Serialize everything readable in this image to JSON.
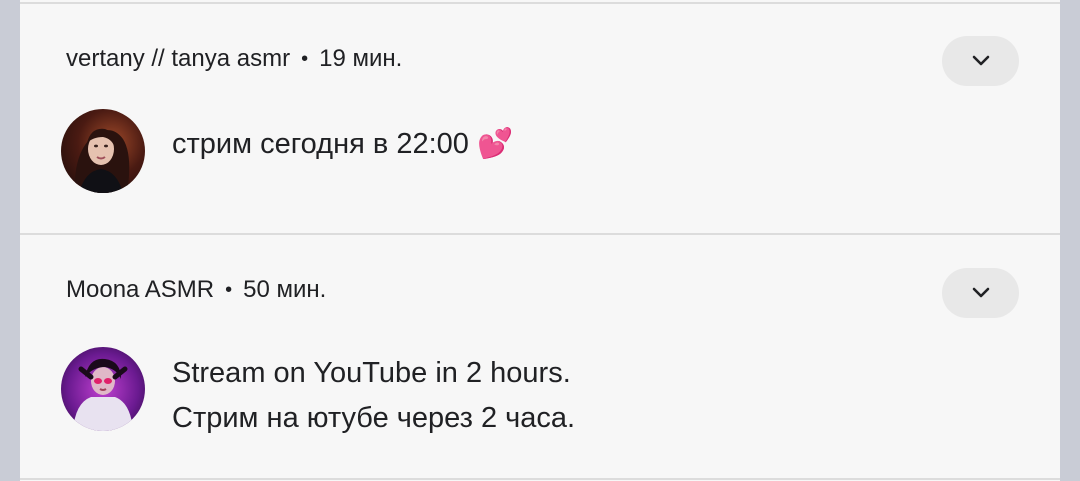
{
  "notifications": [
    {
      "app_name": "vertany // tanya asmr",
      "separator": "•",
      "time": "19 мин.",
      "message_lines": [
        "стрим сегодня в 22:00 💕"
      ],
      "expand_icon": "chevron-down-icon",
      "avatar_icon": "channel-avatar-tanya"
    },
    {
      "app_name": "Moona ASMR",
      "separator": "•",
      "time": "50 мин.",
      "message_lines": [
        "Stream on YouTube in 2 hours.",
        "Стрим на ютубе через 2 часа."
      ],
      "expand_icon": "chevron-down-icon",
      "avatar_icon": "channel-avatar-moona"
    }
  ],
  "colors": {
    "panel_background": "#f7f7f7",
    "outer_background": "#c9ccd6",
    "text": "#202124",
    "expand_button": "#e8e8e8",
    "divider": "#dcdcdc"
  }
}
